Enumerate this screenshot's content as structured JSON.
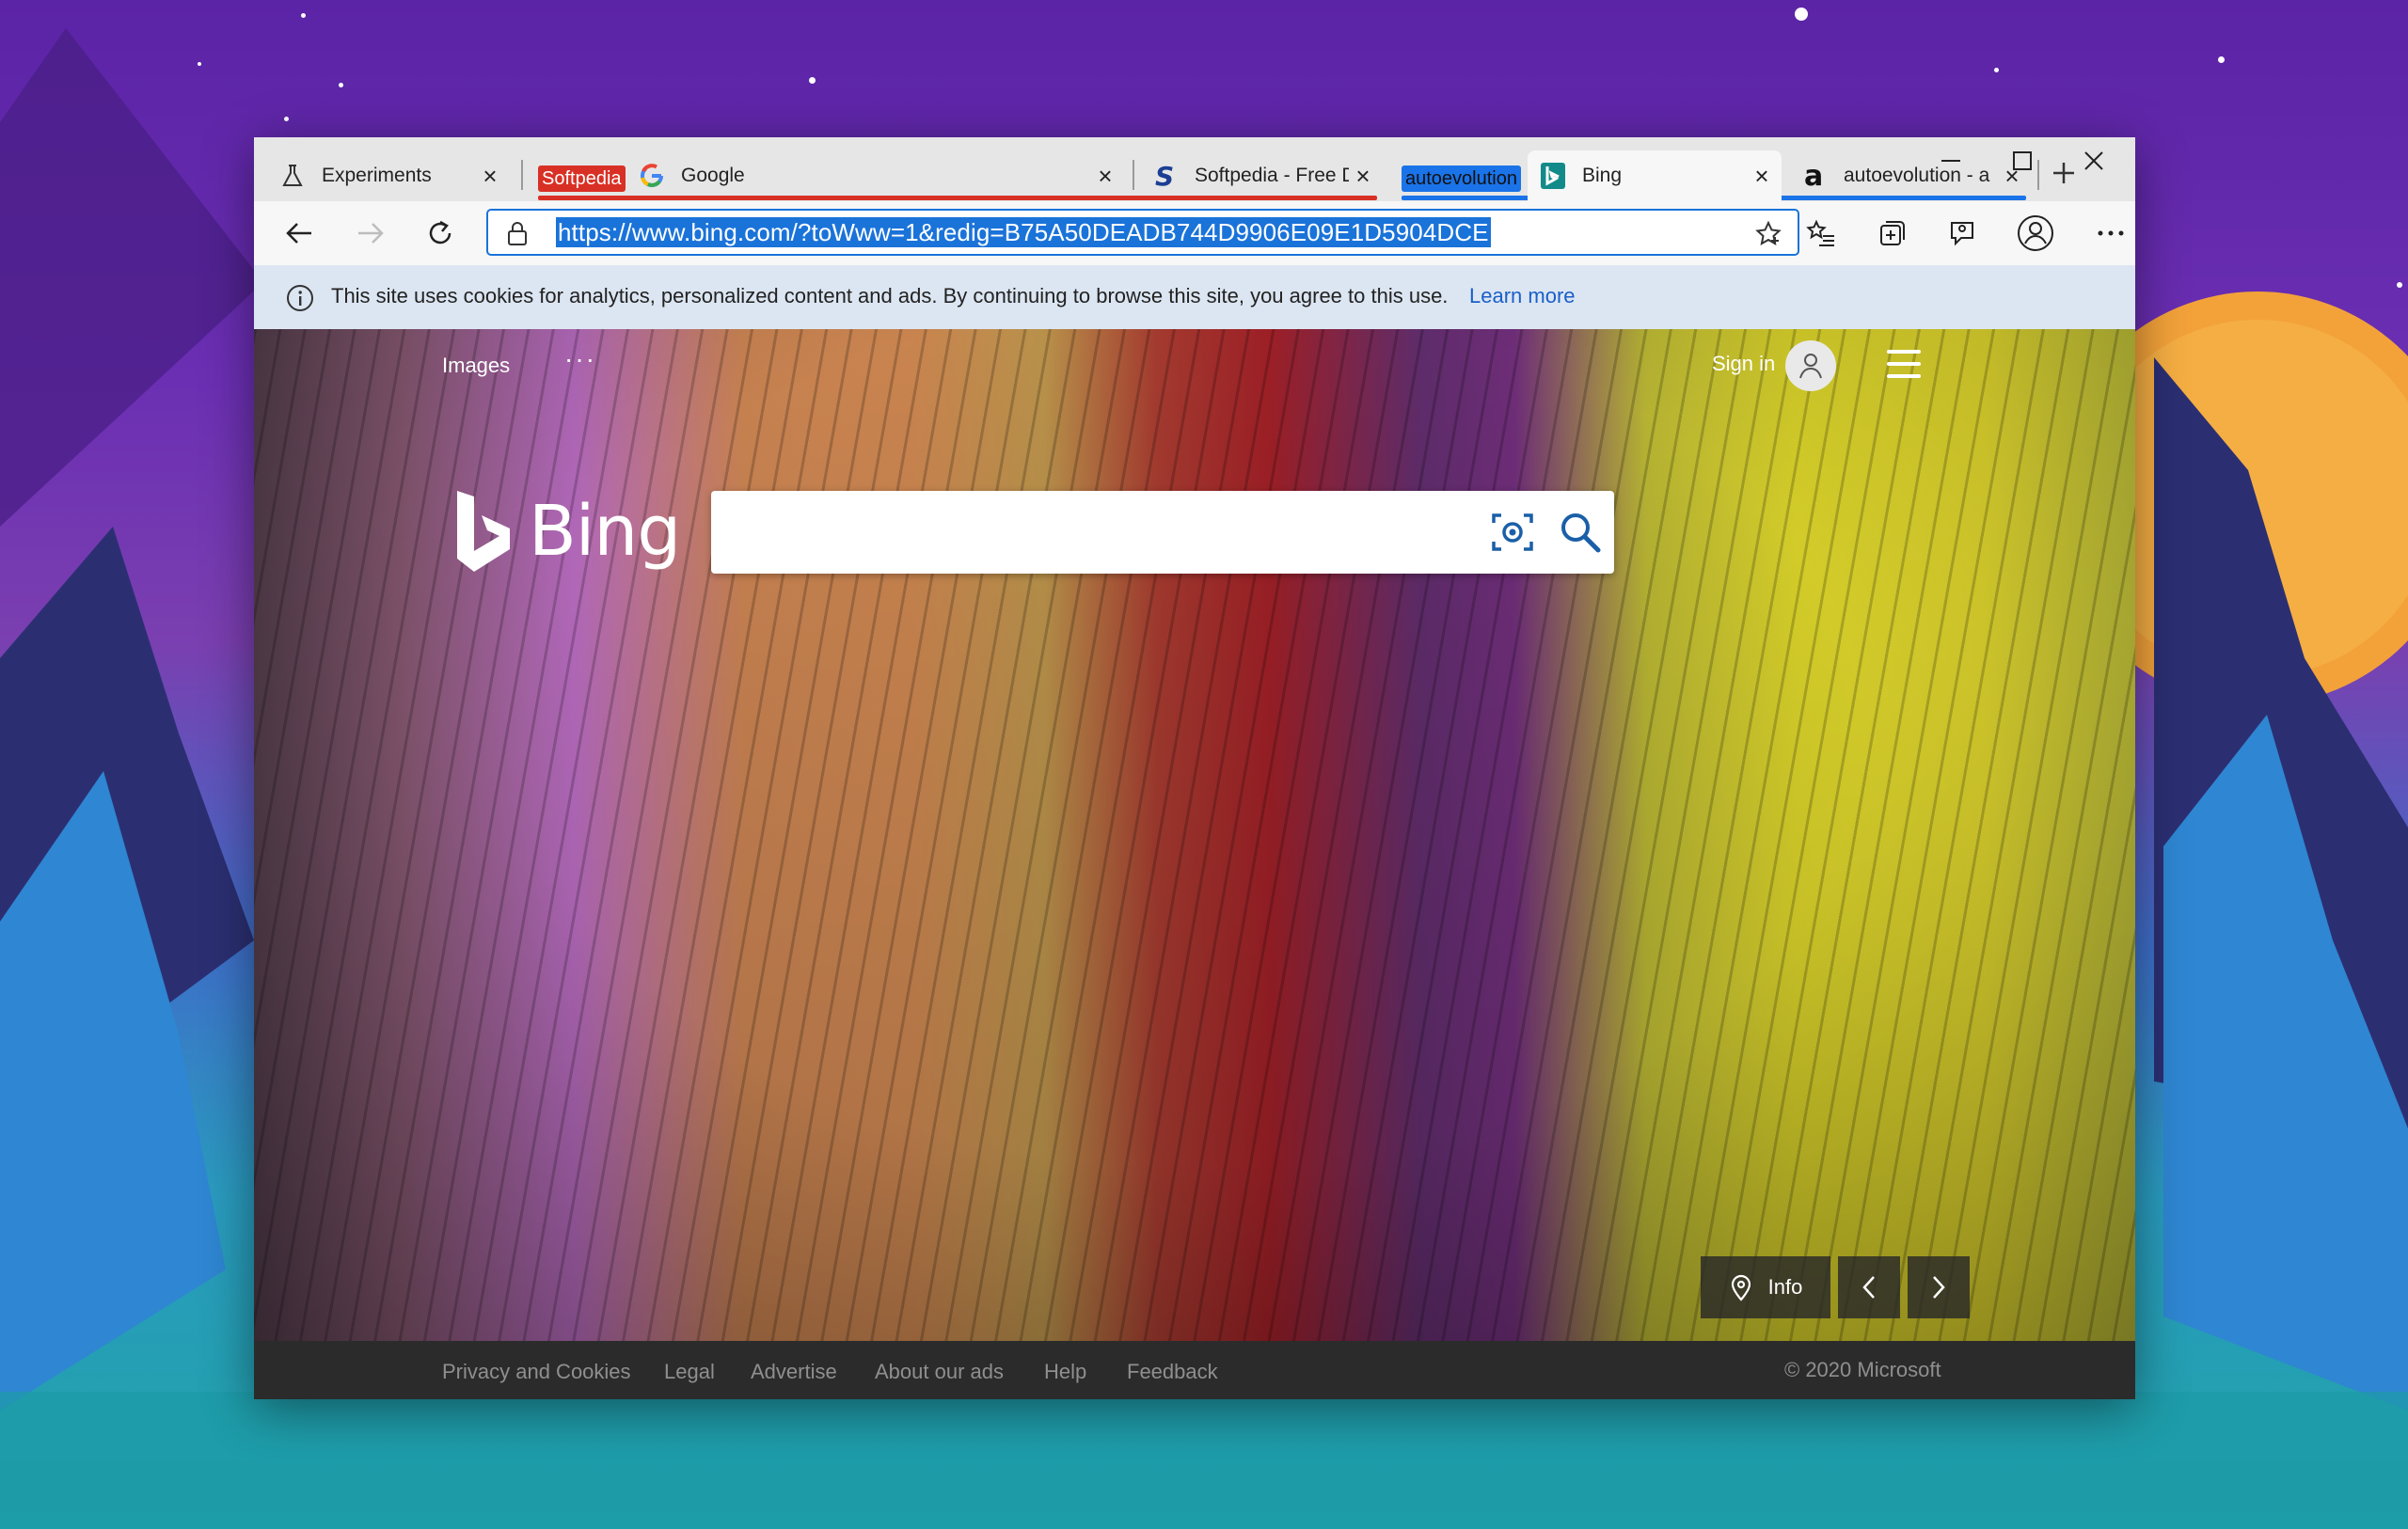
{
  "tabs": [
    {
      "label": "Experiments",
      "icon": "flask-icon"
    },
    {
      "label": "Google",
      "icon": "google-icon",
      "group": "Softpedia"
    },
    {
      "label": "Softpedia - Free D",
      "icon": "softpedia-icon"
    },
    {
      "label": "Bing",
      "icon": "bing-icon",
      "group": "autoevolution",
      "active": true
    },
    {
      "label": "autoevolution - a",
      "icon": "autoevolution-icon"
    }
  ],
  "tab_groups": {
    "softpedia": {
      "label": "Softpedia",
      "color": "#d93025"
    },
    "autoevolution": {
      "label": "autoevolution",
      "color": "#1a73e8"
    }
  },
  "address": {
    "url": "https://www.bing.com/?toWww=1&redig=B75A50DEADB744D9906E09E1D5904DCE"
  },
  "infobar": {
    "text": "This site uses cookies for analytics, personalized content and ads. By continuing to browse this site, you agree to this use.",
    "link": "Learn more"
  },
  "bing": {
    "images_label": "Images",
    "more_label": "···",
    "signin_label": "Sign in",
    "logo_text": "Bing",
    "search_placeholder": "",
    "info_label": "Info"
  },
  "footer": {
    "links": [
      "Privacy and Cookies",
      "Legal",
      "Advertise",
      "About our ads",
      "Help",
      "Feedback"
    ],
    "copyright": "© 2020 Microsoft"
  },
  "colors": {
    "accent": "#1a73d9",
    "infobar": "#dce6f2",
    "footer": "#2b2b2b"
  }
}
